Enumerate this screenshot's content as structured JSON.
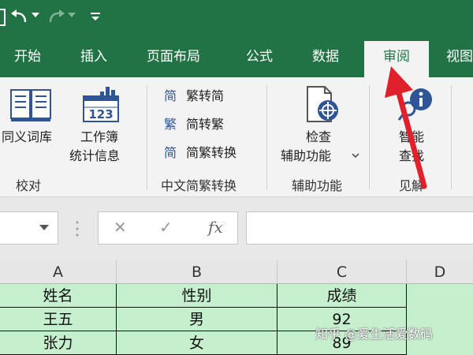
{
  "tabs": [
    {
      "label": "开始"
    },
    {
      "label": "插入"
    },
    {
      "label": "页面布局"
    },
    {
      "label": "公式"
    },
    {
      "label": "数据"
    },
    {
      "label": "审阅"
    },
    {
      "label": "视图"
    }
  ],
  "active_tab": "审阅",
  "ribbon": {
    "proofing": {
      "thesaurus_label": "同义词库",
      "workbook_stats_line1": "工作簿",
      "workbook_stats_line2": "统计信息",
      "group_label": "校对"
    },
    "chinese_conversion": {
      "to_simplified": "繁转简",
      "to_traditional": "简转繁",
      "convert": "简繁转换",
      "group_label": "中文简繁转换"
    },
    "accessibility": {
      "check_line1": "检查",
      "check_line2": "辅助功能",
      "group_label": "辅助功能"
    },
    "insights": {
      "smart_lookup_line1": "智能",
      "smart_lookup_line2": "查找",
      "group_label": "见解"
    }
  },
  "formula_bar": {
    "cancel_symbol": "✕",
    "confirm_symbol": "✓",
    "fx_symbol": "fx"
  },
  "grid": {
    "columns": [
      "A",
      "B",
      "C",
      "D"
    ],
    "rows": [
      [
        "姓名",
        "性别",
        "成绩"
      ],
      [
        "王五",
        "男",
        "92"
      ],
      [
        "张力",
        "女",
        "89"
      ]
    ]
  },
  "watermark": "知乎 @爱生活爱数码",
  "colors": {
    "excel_green": "#217346",
    "cell_fill": "#c6efce",
    "annotation_red": "#e0202a"
  },
  "icons": {
    "save": "save-icon",
    "undo": "undo-icon",
    "redo": "redo-icon",
    "customize": "customize-toolbar-icon"
  }
}
